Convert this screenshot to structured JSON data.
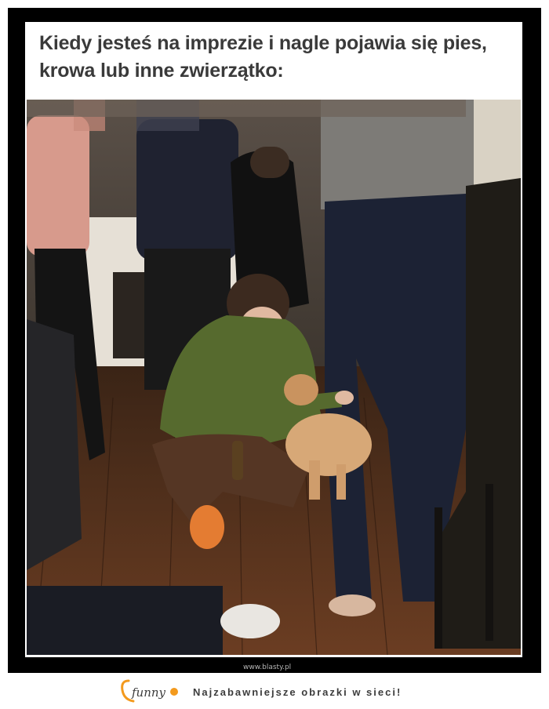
{
  "caption": {
    "text": "Kiedy jesteś na imprezie i nagle pojawia się pies, krowa lub inne zwierzątko:"
  },
  "photo": {
    "description_icon": "party-dog-photo"
  },
  "watermark": {
    "text": "www.blasty.pl"
  },
  "footer": {
    "logo_text": "funny",
    "logo_accent": "#f39a1e",
    "tagline": "Najzabawniejsze obrazki w sieci!"
  }
}
